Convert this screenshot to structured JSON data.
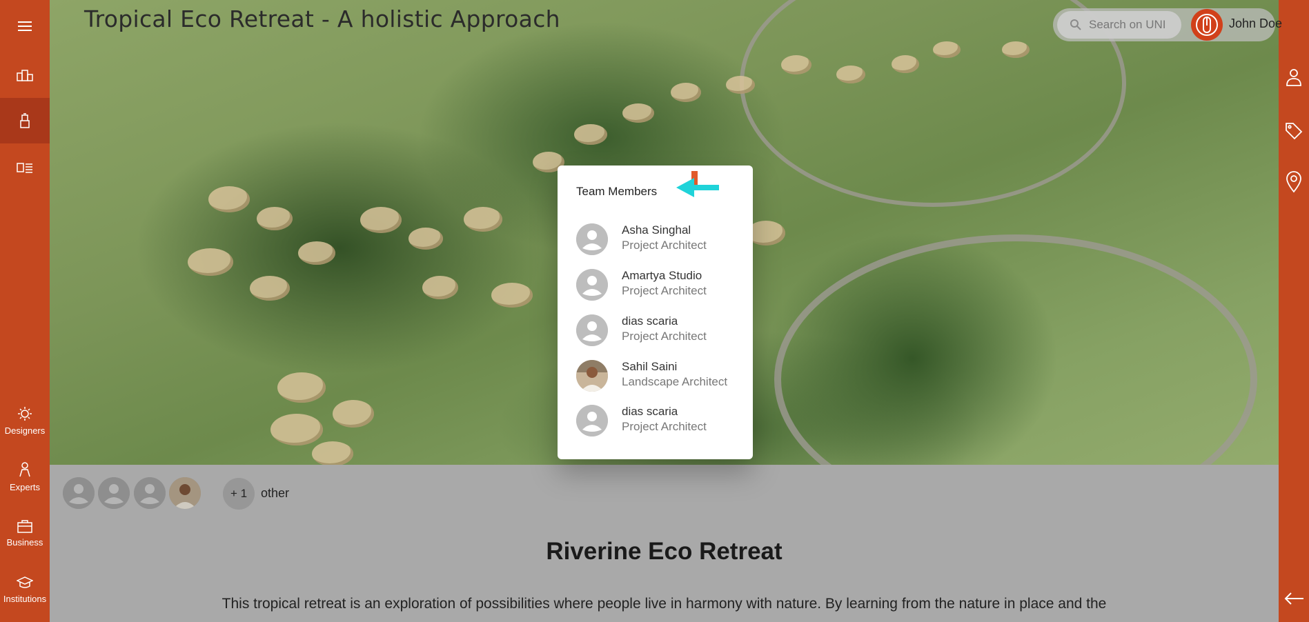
{
  "sidebar": {
    "items": [
      {
        "icon": "menu-icon"
      },
      {
        "icon": "buildings-icon"
      },
      {
        "icon": "projects-icon"
      },
      {
        "icon": "list-icon"
      },
      {
        "icon": "designers-icon",
        "label": "Designers"
      },
      {
        "icon": "experts-icon",
        "label": "Experts"
      },
      {
        "icon": "business-icon",
        "label": "Business"
      },
      {
        "icon": "institutions-icon",
        "label": "Institutions"
      }
    ],
    "colors": {
      "background": "#c4481f",
      "active": "#a9381a"
    }
  },
  "right_sidebar": {
    "icons": [
      "person-icon",
      "tag-icon",
      "location-pin-icon",
      "back-arrow-icon"
    ]
  },
  "header": {
    "project_heading": "Tropical Eco Retreat - A holistic Approach",
    "search_placeholder": "Search on UNI",
    "user_name": "John Doe"
  },
  "team_popup": {
    "title": "Team Members",
    "members": [
      {
        "name": "Asha Singhal",
        "role": "Project Architect",
        "avatar": "default-avatar"
      },
      {
        "name": "Amartya Studio",
        "role": "Project Architect",
        "avatar": "default-avatar"
      },
      {
        "name": "dias scaria",
        "role": "Project Architect",
        "avatar": "default-avatar"
      },
      {
        "name": "Sahil Saini",
        "role": "Landscape Architect",
        "avatar": "photo"
      },
      {
        "name": "dias scaria",
        "role": "Project Architect",
        "avatar": "default-avatar"
      }
    ]
  },
  "team_strip": {
    "more_count": "+ 1",
    "more_label": "other"
  },
  "project": {
    "title": "Riverine Eco Retreat",
    "description": "This tropical retreat is an exploration of possibilities where people live in harmony with nature. By learning from the nature in place and the"
  },
  "colors": {
    "accent": "#c4481f",
    "annotation_arrow": "#1fd3d9"
  }
}
